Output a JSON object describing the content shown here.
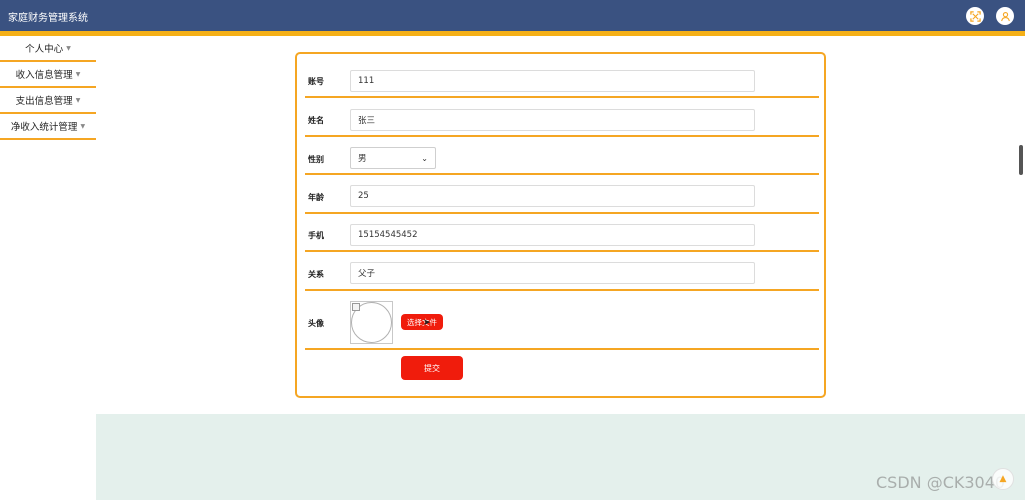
{
  "app": {
    "title": "家庭财务管理系统"
  },
  "header_icons": [
    "fullscreen-icon",
    "user-icon"
  ],
  "colors": {
    "header": "#3a5281",
    "accent": "#f5a623",
    "button": "#f01c0c",
    "band": "#e4f0ec"
  },
  "sidebar": {
    "items": [
      {
        "label": "个人中心"
      },
      {
        "label": "收入信息管理"
      },
      {
        "label": "支出信息管理"
      },
      {
        "label": "净收入统计管理"
      }
    ]
  },
  "form": {
    "account_label": "账号",
    "account_value": "111",
    "name_label": "姓名",
    "name_value": "张三",
    "gender_label": "性别",
    "gender_value": "男",
    "age_label": "年龄",
    "age_value": "25",
    "phone_label": "手机",
    "phone_value": "15154545452",
    "relation_label": "关系",
    "relation_value": "父子",
    "avatar_label": "头像",
    "choose_file_label": "选择文件",
    "submit_label": "提交"
  },
  "watermark": "CSDN @CK3040"
}
